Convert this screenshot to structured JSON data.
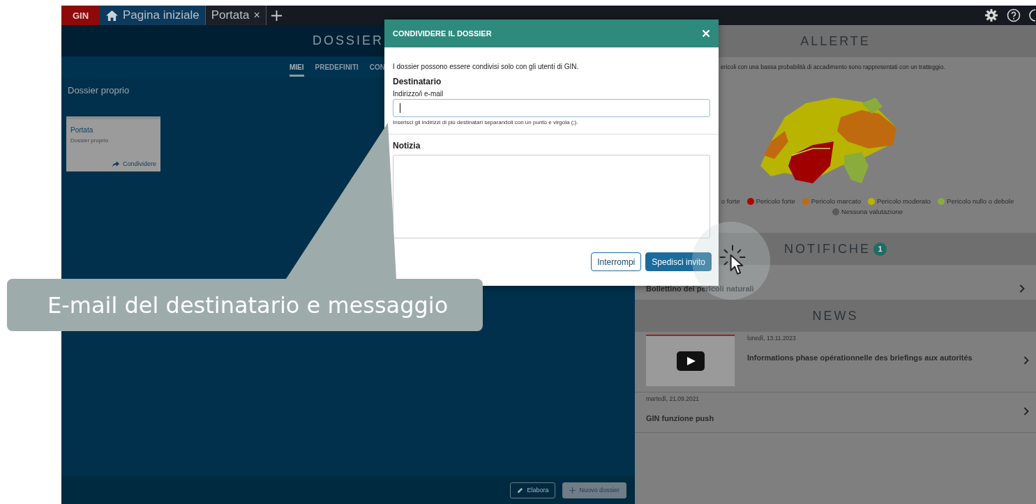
{
  "top_bar": {
    "logo": "GIN",
    "tabs": [
      {
        "label": "Pagina iniziale",
        "kind": "home",
        "selected": true
      },
      {
        "label": "Portata",
        "kind": "closable",
        "close_label": "×",
        "selected": false
      }
    ]
  },
  "dossier_panel": {
    "title": "DOSSIER",
    "tabs": [
      {
        "label": "MIEI",
        "selected": true
      },
      {
        "label": "PREDEFINITI",
        "selected": false
      },
      {
        "label": "CON",
        "selected": false
      }
    ],
    "section": "Dossier proprio",
    "cards": [
      {
        "title": "Portata",
        "subtitle": "Dossier proprio",
        "action": "Condividere"
      }
    ],
    "buttons": [
      {
        "label": "Elabora",
        "kind": "edit"
      },
      {
        "label": "Nuovo dossier",
        "kind": "add"
      }
    ]
  },
  "alerts": {
    "title": "ALLERTE",
    "note": "ericoli con una bassa probabilità di accadimento sono rappresentati con un tratteggio.",
    "legend": [
      {
        "label": "o forte"
      },
      {
        "label": "Pericolo forte",
        "color": "#b00000"
      },
      {
        "label": "Pericolo marcato",
        "color": "#c06a10"
      },
      {
        "label": "Pericolo moderato",
        "color": "#b8b400"
      },
      {
        "label": "Pericolo nullo o debole",
        "color": "#8aac3c"
      },
      {
        "label": "Nessuna valutazione",
        "color": "#5a5a5a"
      }
    ]
  },
  "notifications": {
    "title": "NOTIFICHE",
    "count": "1",
    "items": [
      {
        "label": "Bollettino dei pericoli naturali"
      }
    ]
  },
  "news": {
    "title": "NEWS",
    "items": [
      {
        "kind": "video",
        "date": "lunedì, 13.11.2023",
        "title": "Informations phase opérationnelle des briefings aux autorités"
      },
      {
        "kind": "text",
        "date": "martedì, 21.09.2021",
        "title": "GIN funzione push"
      }
    ]
  },
  "dialog": {
    "title": "CONDIVIDERE IL DOSSIER",
    "intro": "I dossier possono essere condivisi solo con gli utenti di GIN.",
    "recipient_heading": "Destinatario",
    "email_label": "Indirizzo/i e-mail",
    "email_hint": "Inserisci gli indirizzi di più destinatari separandoli con un punto e virgola (;).",
    "message_label": "Notizia",
    "buttons": [
      {
        "label": "Interrompi",
        "kind": "secondary"
      },
      {
        "label": "Spedisci invito",
        "kind": "primary"
      }
    ]
  },
  "callout": {
    "text": "E-mail del destinatario e messaggio"
  }
}
